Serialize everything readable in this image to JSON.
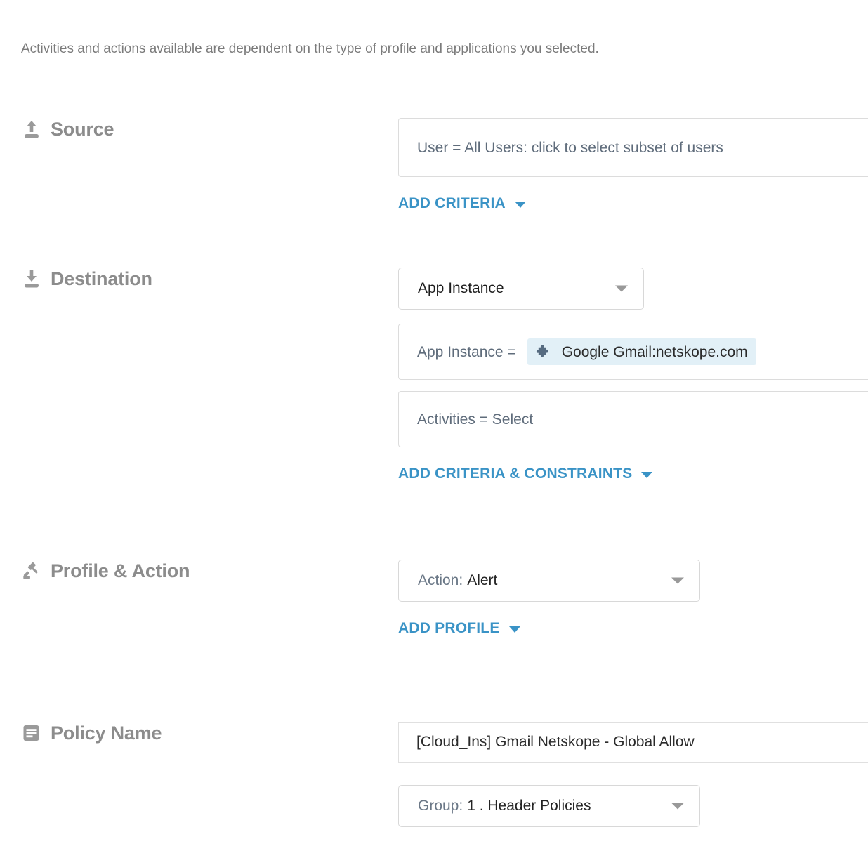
{
  "intro": {
    "note": "Activities and actions available are dependent on the type of profile and applications you selected."
  },
  "sections": {
    "source": {
      "title": "Source",
      "icon": "upload-icon",
      "criteria_field": "User = All Users: click to select subset of users",
      "add_link": "ADD CRITERIA"
    },
    "destination": {
      "title": "Destination",
      "icon": "download-icon",
      "type_select": "App Instance",
      "criteria_prefix": "App Instance =",
      "criteria_chip": "Google Gmail:netskope.com",
      "chip_icon": "puzzle-piece-icon",
      "activities_field": "Activities = Select",
      "add_link": "ADD CRITERIA & CONSTRAINTS"
    },
    "profile_action": {
      "title": "Profile & Action",
      "icon": "gavel-icon",
      "action_prefix": "Action:",
      "action_value": "Alert",
      "add_link": "ADD PROFILE"
    },
    "policy_name": {
      "title": "Policy Name",
      "icon": "document-lines-icon",
      "name_value": "[Cloud_Ins] Gmail Netskope - Global Allow",
      "group_prefix": "Group:",
      "group_value": "1 . Header Policies"
    }
  },
  "colors": {
    "link_blue": "#3a93c6",
    "label_grey": "#8c8c8c",
    "field_text": "#5f6c7b",
    "chip_background": "#e2f0f7",
    "chip_icon": "#566b80",
    "border": "#dcdcdc"
  }
}
